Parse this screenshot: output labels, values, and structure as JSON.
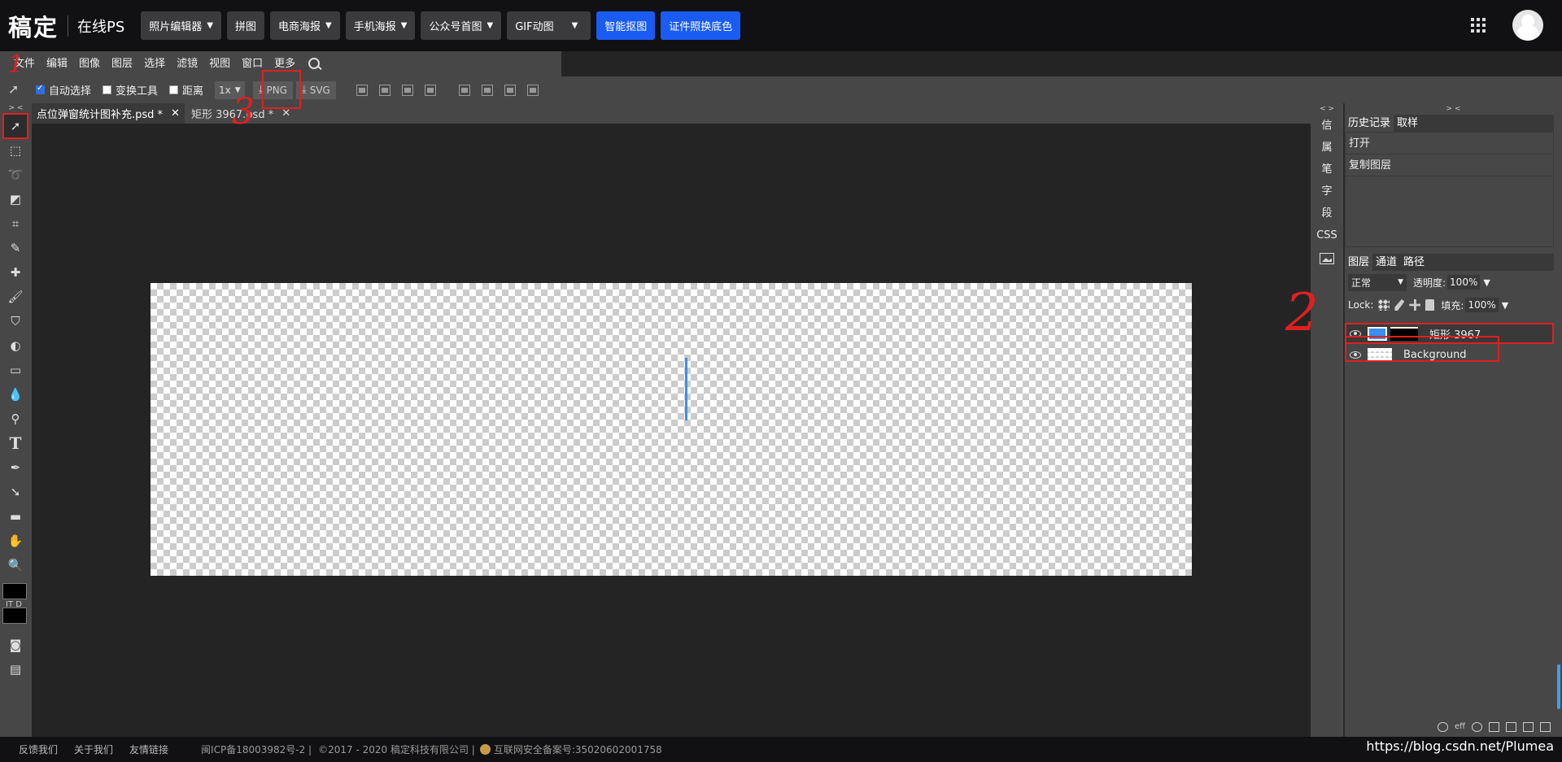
{
  "nav": {
    "logo": "稿定",
    "subtitle": "在线PS",
    "buttons": [
      {
        "label": "照片编辑器",
        "caret": true
      },
      {
        "label": "拼图",
        "caret": false
      },
      {
        "label": "电商海报",
        "caret": true
      },
      {
        "label": "手机海报",
        "caret": true
      },
      {
        "label": "公众号首图",
        "caret": true
      },
      {
        "label": "GIF动图",
        "caret": true
      }
    ],
    "blue_buttons": [
      "智能抠图",
      "证件照换底色"
    ]
  },
  "menu": [
    "文件",
    "编辑",
    "图像",
    "图层",
    "选择",
    "滤镜",
    "视图",
    "窗口",
    "更多"
  ],
  "options": {
    "auto_select": "自动选择",
    "transform": "变换工具",
    "distance": "距离",
    "zoom": "1x",
    "png": "PNG",
    "svg": "SVG"
  },
  "tabs": [
    {
      "label": "点位弹窗统计图补充.psd *",
      "close": "✕"
    },
    {
      "label": "矩形 3967.psd *",
      "close": "✕"
    }
  ],
  "side_items": [
    "信",
    "属",
    "笔",
    "字",
    "段",
    "CSS"
  ],
  "collapse_marks": {
    "toolbar": "> <",
    "mini": "< >",
    "right": "> <"
  },
  "history": {
    "tabs": [
      "历史记录",
      "取样"
    ],
    "items": [
      "打开",
      "复制图层"
    ]
  },
  "layers_panel": {
    "tabs": [
      "图层",
      "通道",
      "路径"
    ],
    "blend": "正常",
    "opacity_label": "透明度:",
    "opacity": "100%",
    "lock_label": "Lock:",
    "fill_label": "填充:",
    "fill": "100%",
    "layers": [
      "矩形 3967",
      "Background"
    ],
    "footer_eff": "eff"
  },
  "tool_labels": {
    "color_mode": "IT D"
  },
  "annotations": {
    "one": "1",
    "two": "2",
    "three": "3"
  },
  "footer": {
    "links": [
      "反馈我们",
      "关于我们",
      "友情链接"
    ],
    "icp": "闽ICP备18003982号-2 |",
    "copyright": "©2017 - 2020 稿定科技有限公司 |",
    "security": "互联网安全备案号:35020602001758"
  },
  "watermark": "https://blog.csdn.net/Plumea"
}
